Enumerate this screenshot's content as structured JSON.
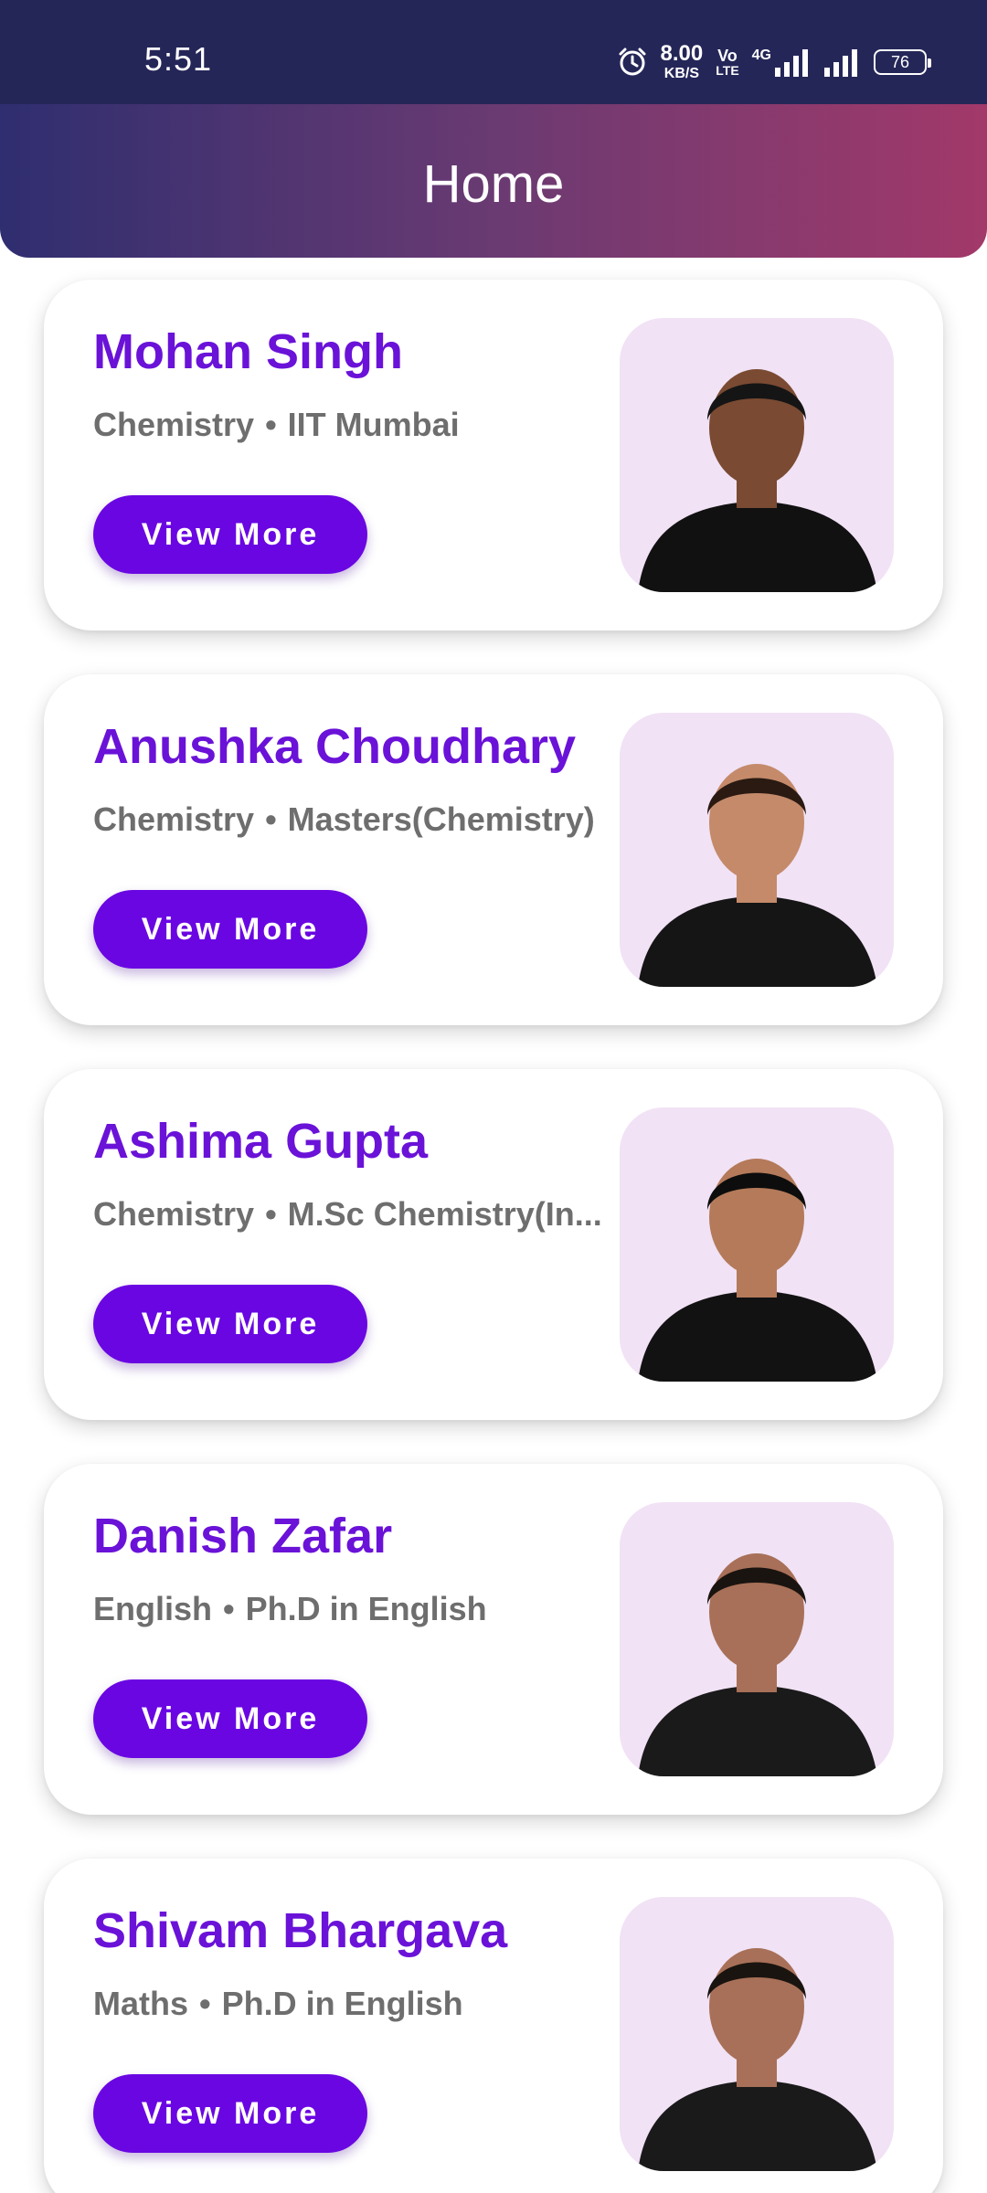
{
  "status_bar": {
    "time": "5:51",
    "net_speed_value": "8.00",
    "net_speed_unit": "KB/S",
    "volte_top": "Vo",
    "volte_bottom": "LTE",
    "network_type": "4G",
    "battery": "76",
    "icons": [
      "alarm-icon",
      "signal-icon",
      "signal-icon",
      "battery-icon"
    ]
  },
  "header": {
    "title": "Home"
  },
  "colors": {
    "accent": "#6a06e2",
    "name": "#6a12d8",
    "subtitle": "#6e6e6e",
    "photo_bg": "#f1e2f5",
    "status_bg": "#252658",
    "header_gradient": [
      "#2f2e70",
      "#a2396a"
    ]
  },
  "teachers": [
    {
      "name": "Mohan Singh",
      "subject": "Chemistry",
      "separator": "•",
      "qualification": "IIT Mumbai",
      "button": "View More",
      "shirt": "#111111",
      "hair": "#151515",
      "skin": "#7a4a32"
    },
    {
      "name": "Anushka Choudhary",
      "subject": "Chemistry",
      "separator": "•",
      "qualification": "Masters(Chemistry)",
      "button": "View More",
      "shirt": "#151515",
      "hair": "#2a1a12",
      "skin": "#c48a6a"
    },
    {
      "name": "Ashima Gupta",
      "subject": "Chemistry",
      "separator": "•",
      "qualification": "M.Sc Chemistry(In...",
      "button": "View More",
      "shirt": "#121212",
      "hair": "#0d0d0d",
      "skin": "#b47a5a"
    },
    {
      "name": "Danish Zafar",
      "subject": "English",
      "separator": "•",
      "qualification": "Ph.D in English",
      "button": "View More",
      "shirt": "#1a1a1a",
      "hair": "#1a1410",
      "skin": "#a87058"
    },
    {
      "name": "Shivam Bhargava",
      "subject": "Maths",
      "separator": "•",
      "qualification": "Ph.D in English",
      "button": "View More",
      "shirt": "#1a1a1a",
      "hair": "#1a1410",
      "skin": "#a87058"
    }
  ]
}
